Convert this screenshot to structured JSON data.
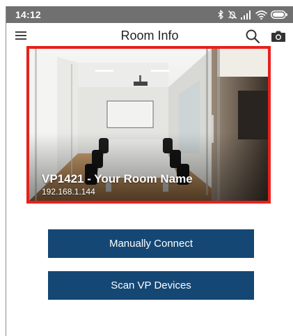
{
  "status_bar": {
    "time": "14:12",
    "icons": [
      "bluetooth-icon",
      "silent-icon",
      "signal-icon",
      "wifi-icon",
      "battery-icon"
    ]
  },
  "app_bar": {
    "title": "Room Info",
    "icons": [
      "menu-icon",
      "search-icon",
      "camera-icon"
    ]
  },
  "room_card": {
    "name": "VP1421 - Your Room Name",
    "ip": "192.168.1.144",
    "highlight_color": "#e8201b"
  },
  "actions": {
    "manual_connect": "Manually Connect",
    "scan_devices": "Scan VP Devices"
  },
  "colors": {
    "status_bar_bg": "#707070",
    "button_bg": "#144774",
    "button_text": "#ffffff"
  }
}
